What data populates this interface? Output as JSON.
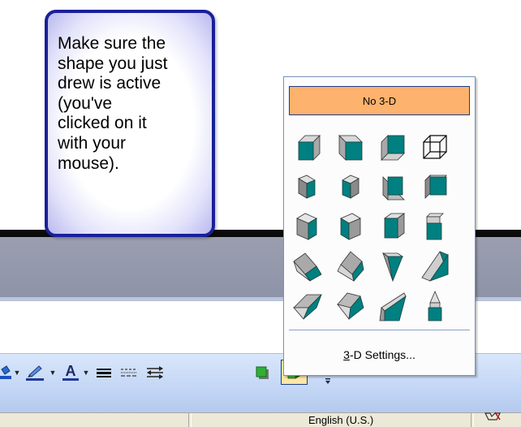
{
  "callout": {
    "lines": [
      "Make sure the",
      "shape you just",
      "drew is active",
      "(you've",
      "clicked on it",
      "with your",
      "mouse)."
    ]
  },
  "popup": {
    "no3d_label": "No 3-D",
    "settings_label_accel": "3",
    "settings_label_rest": "-D Settings...",
    "styles": [
      "3d-style-1",
      "3d-style-2",
      "3d-style-3",
      "3d-style-4",
      "3d-style-5",
      "3d-style-6",
      "3d-style-7",
      "3d-style-8",
      "3d-style-9",
      "3d-style-10",
      "3d-style-11",
      "3d-style-12",
      "3d-style-13",
      "3d-style-14",
      "3d-style-15",
      "3d-style-16",
      "3d-style-17",
      "3d-style-18",
      "3d-style-19",
      "3d-style-20"
    ]
  },
  "toolbar": {
    "font_color_glyph": "A",
    "icons": [
      "fill-color-icon",
      "line-color-icon",
      "font-color-icon",
      "line-style-icon",
      "dash-style-icon",
      "arrow-style-icon",
      "shadow-style-icon",
      "3d-style-icon"
    ]
  },
  "status": {
    "language": "English (U.S.)"
  },
  "colors": {
    "accent": "#008080",
    "highlight": "#fdb26d",
    "callout_border": "#1a1f9a"
  }
}
